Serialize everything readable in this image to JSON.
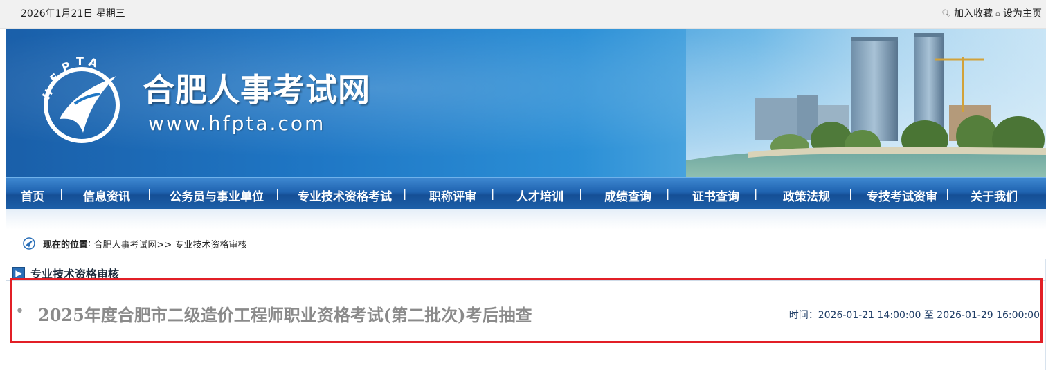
{
  "topbar": {
    "date": "2026年1月21日 星期三",
    "bookmark_label": "加入收藏",
    "homepage_label": "设为主页"
  },
  "banner": {
    "site_name": "合肥人事考试网",
    "site_url": "www.hfpta.com",
    "logo_text": "HFPTA"
  },
  "nav": {
    "items": [
      {
        "label": "首页"
      },
      {
        "label": "信息资讯"
      },
      {
        "label": "公务员与事业单位"
      },
      {
        "label": "专业技术资格考试"
      },
      {
        "label": "职称评审"
      },
      {
        "label": "人才培训"
      },
      {
        "label": "成绩查询"
      },
      {
        "label": "证书查询"
      },
      {
        "label": "政策法规"
      },
      {
        "label": "专技考试资审"
      },
      {
        "label": "关于我们"
      }
    ],
    "separator": "|"
  },
  "breadcrumb": {
    "label": "现在的位置",
    "colon": ":",
    "path": " 合肥人事考试网>> 专业技术资格审核"
  },
  "section": {
    "title": "专业技术资格审核"
  },
  "news": [
    {
      "title": "2025年度合肥市二级造价工程师职业资格考试(第二批次)考后抽查",
      "time": "时间：2026-01-21 14:00:00 至 2026-01-29 16:00:00"
    }
  ],
  "colors": {
    "nav_bg": "#1f63b0",
    "highlight_border": "#e21f26",
    "news_title": "#8a8a8a"
  }
}
